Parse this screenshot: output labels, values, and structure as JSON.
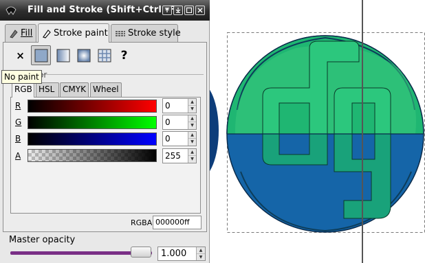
{
  "window": {
    "title": "Fill and Stroke (Shift+Ctrl+F)",
    "controls": [
      "pin-icon",
      "minimize-icon",
      "maximize-icon",
      "close-icon"
    ]
  },
  "tabs": [
    {
      "label": "Fill",
      "icon": "fill-icon"
    },
    {
      "label": "Stroke paint",
      "icon": "stroke-paint-icon",
      "active": true
    },
    {
      "label": "Stroke style",
      "icon": "stroke-style-icon"
    }
  ],
  "paint_buttons": [
    {
      "label": "×",
      "name": "no-paint-button"
    },
    {
      "name": "flat-color-button",
      "selected": true
    },
    {
      "name": "linear-gradient-button"
    },
    {
      "name": "radial-gradient-button"
    },
    {
      "name": "pattern-button"
    },
    {
      "label": "?",
      "name": "unset-paint-button"
    }
  ],
  "tooltip": "No paint",
  "section_label": "or",
  "color_modes": [
    {
      "label": "RGB",
      "active": true
    },
    {
      "label": "HSL"
    },
    {
      "label": "CMYK"
    },
    {
      "label": "Wheel"
    }
  ],
  "channels": [
    {
      "label": "R",
      "value": "0"
    },
    {
      "label": "G",
      "value": "0"
    },
    {
      "label": "B",
      "value": "0"
    },
    {
      "label": "A",
      "value": "255"
    }
  ],
  "rgba": {
    "label": "RGBA:",
    "value": "000000ff"
  },
  "master_opacity": {
    "label": "Master opacity",
    "value": "1.000",
    "fraction": 1.0
  },
  "colors": {
    "titlebar": "#2e2e2e",
    "slider_red": "#ff0000",
    "slider_green": "#00ff00",
    "slider_blue": "#0000ff",
    "opacity_track": "#7a2f86",
    "canvas_green": "#1abc7a",
    "canvas_blue": "#1565a8",
    "canvas_dark_blue": "#0d3d7a"
  }
}
